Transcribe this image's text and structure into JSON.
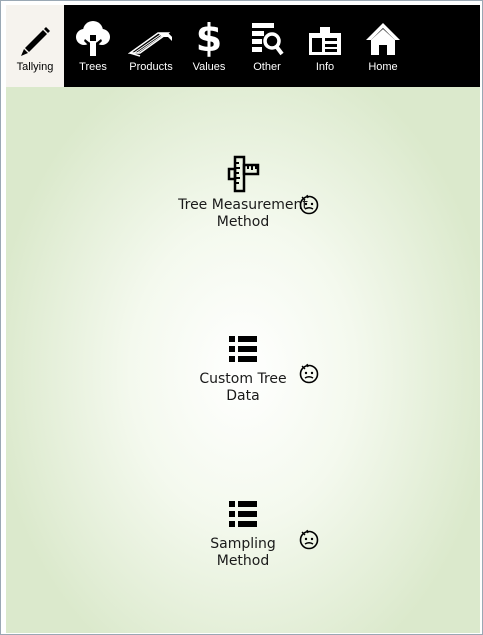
{
  "tabs": [
    {
      "id": "tallying",
      "label": "Tallying",
      "icon": "pencil-icon",
      "active": true
    },
    {
      "id": "trees",
      "label": "Trees",
      "icon": "tree-icon"
    },
    {
      "id": "products",
      "label": "Products",
      "icon": "products-icon"
    },
    {
      "id": "values",
      "label": "Values",
      "icon": "dollar-icon"
    },
    {
      "id": "other",
      "label": "Other",
      "icon": "search-list-icon"
    },
    {
      "id": "info",
      "label": "Info",
      "icon": "id-card-icon"
    },
    {
      "id": "home",
      "label": "Home",
      "icon": "home-icon"
    }
  ],
  "items": [
    {
      "label": "Tree Measurement Method",
      "icon": "ruler-icon",
      "hint_icon": "help-face-icon"
    },
    {
      "label": "Custom Tree Data",
      "icon": "list-icon",
      "hint_icon": "help-face-icon"
    },
    {
      "label": "Sampling Method",
      "icon": "list-icon",
      "hint_icon": "help-face-icon"
    }
  ],
  "colors": {
    "toolbar": "#000000",
    "active_tab": "#f6f3ee",
    "content_edge": "#dbe9cc"
  }
}
